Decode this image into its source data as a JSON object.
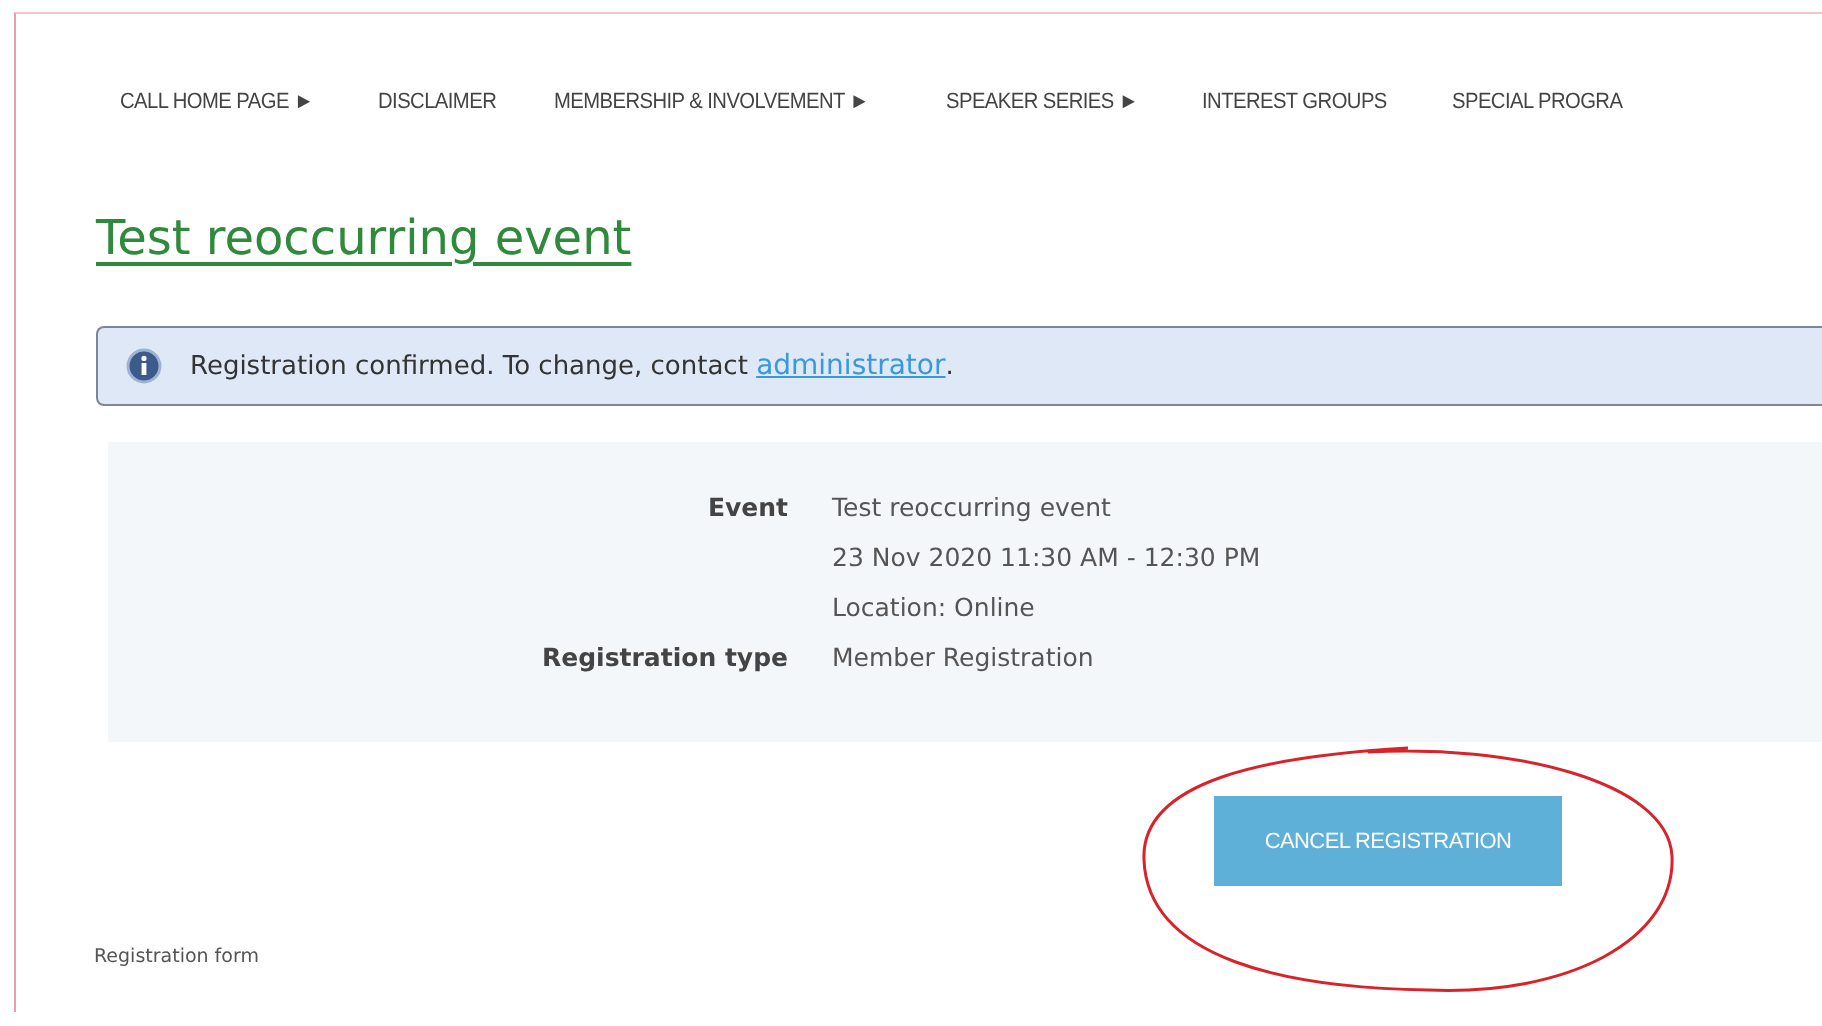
{
  "nav": {
    "items": [
      {
        "label": "CALL HOME PAGE ►"
      },
      {
        "label": "DISCLAIMER"
      },
      {
        "label": "MEMBERSHIP & INVOLVEMENT ►"
      },
      {
        "label": "SPEAKER SERIES ►"
      },
      {
        "label": "INTEREST GROUPS"
      },
      {
        "label": "SPECIAL PROGRA"
      }
    ]
  },
  "title": "Test reoccurring event",
  "alert": {
    "text": "Registration confirmed. To change, contact ",
    "link": "administrator",
    "after": "."
  },
  "details": [
    {
      "label": "Event",
      "values": [
        "Test reoccurring event",
        "23 Nov 2020 11:30 AM - 12:30 PM",
        "Location: Online"
      ]
    },
    {
      "label": "Registration type",
      "values": [
        "Member Registration"
      ]
    }
  ],
  "cancel_button": {
    "label": "CANCEL REGISTRATION"
  },
  "annotation": {
    "kind": "circle"
  },
  "section_label": "Registration form"
}
